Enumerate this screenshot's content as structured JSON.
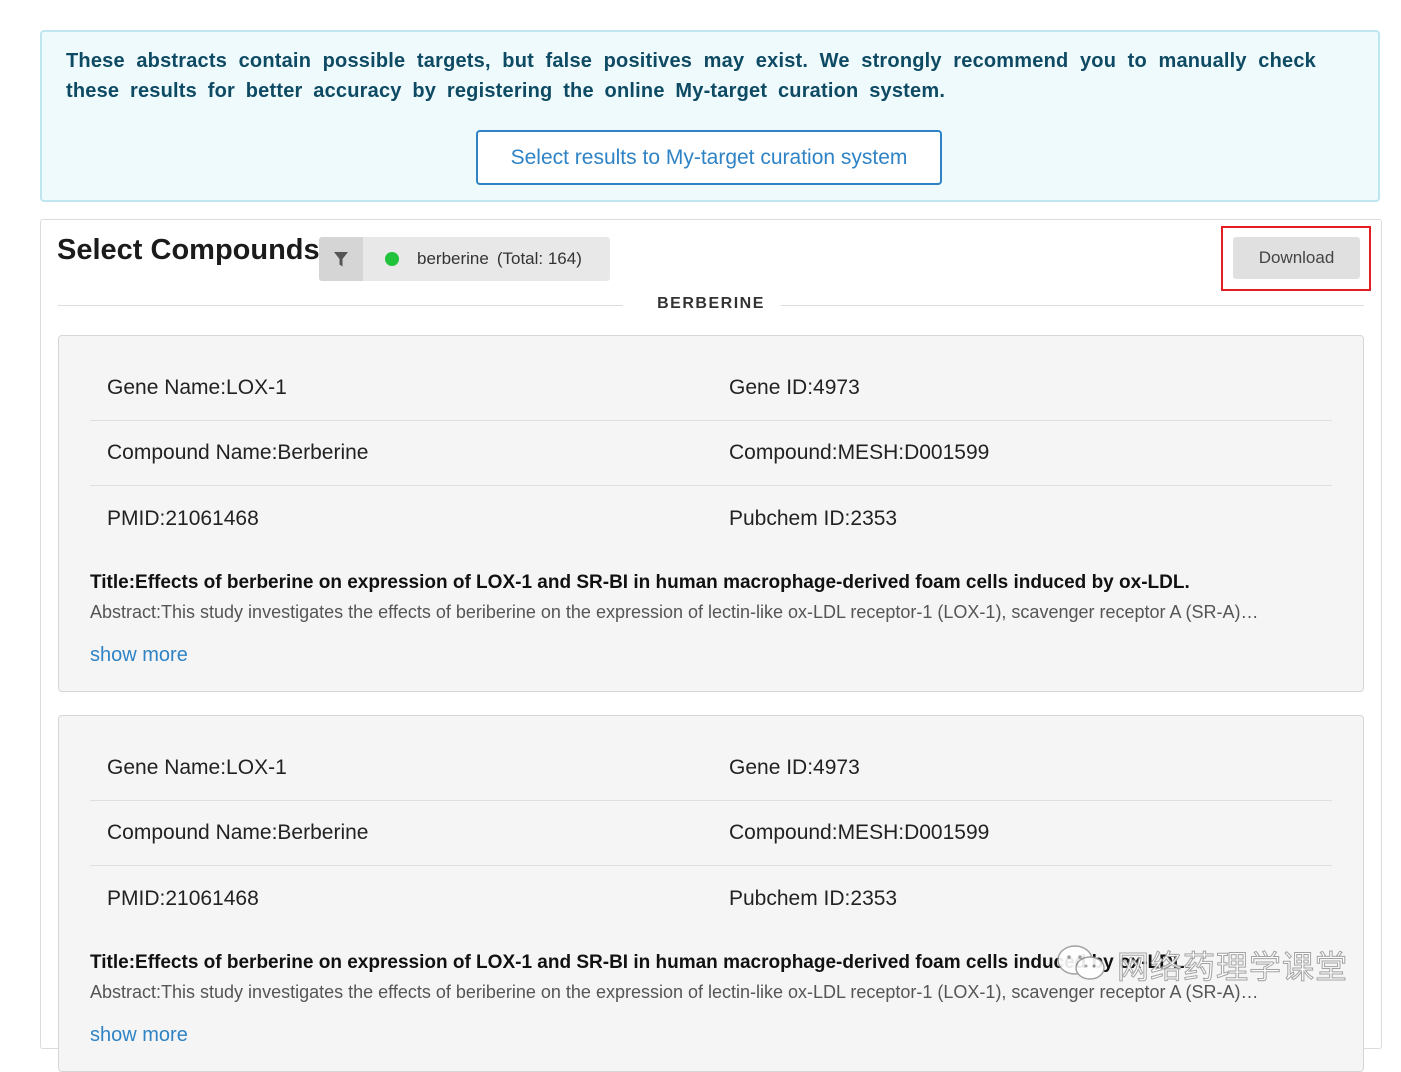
{
  "notice": {
    "text": "These abstracts contain possible targets, but false positives may exist. We strongly recommend you to manually check these results for better accuracy by registering the online My-target curation system.",
    "button_label": "Select results to My-target curation system"
  },
  "compounds": {
    "heading": "Select Compounds:",
    "filter_icon": "filter-icon",
    "chip_name": "berberine",
    "chip_total": "(Total: 164)",
    "chip_status_color": "#21c23c",
    "download_label": "Download",
    "section_label": "BERBERINE"
  },
  "results": [
    {
      "gene_name": "Gene Name:LOX-1",
      "gene_id": "Gene ID:4973",
      "compound_name": "Compound Name:Berberine",
      "compound_mesh": "Compound:MESH:D001599",
      "pmid": "PMID:21061468",
      "pubchem_id": "Pubchem ID:2353",
      "title": "Title:Effects of berberine on expression of LOX-1 and SR-BI in human macrophage-derived foam cells induced by ox-LDL.",
      "abstract": "Abstract:This study investigates the effects of beriberine on the expression of lectin-like ox-LDL receptor-1 (LOX-1), scavenger receptor A (SR-A)…",
      "show_more": "show more"
    },
    {
      "gene_name": "Gene Name:LOX-1",
      "gene_id": "Gene ID:4973",
      "compound_name": "Compound Name:Berberine",
      "compound_mesh": "Compound:MESH:D001599",
      "pmid": "PMID:21061468",
      "pubchem_id": "Pubchem ID:2353",
      "title": "Title:Effects of berberine on expression of LOX-1 and SR-BI in human macrophage-derived foam cells induced by ox-LDL.",
      "abstract": "Abstract:This study investigates the effects of beriberine on the expression of lectin-like ox-LDL receptor-1 (LOX-1), scavenger receptor A (SR-A)…",
      "show_more": "show more"
    }
  ],
  "watermark": {
    "icon": "wechat-icon",
    "text": "网络药理学课堂"
  }
}
